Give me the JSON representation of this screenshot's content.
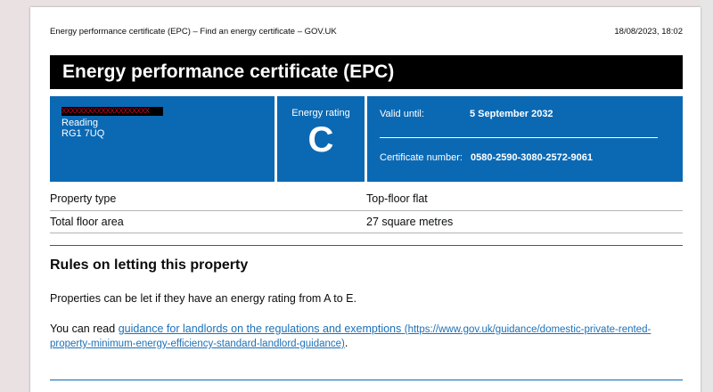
{
  "print_header": {
    "page_title": "Energy performance certificate (EPC) – Find an energy certificate – GOV.UK",
    "timestamp": "18/08/2023, 18:02"
  },
  "certificate": {
    "heading": "Energy performance certificate (EPC)",
    "address": {
      "line1_redacted": "XXXXXXXXXXXXXXXXXXXX",
      "town": "Reading",
      "postcode": "RG1 7UQ"
    },
    "rating_label": "Energy rating",
    "rating": "C",
    "valid_until_label": "Valid until:",
    "valid_until": "5 September 2032",
    "cert_number_label": "Certificate number:",
    "cert_number": "0580-2590-3080-2572-9061"
  },
  "summary": [
    {
      "label": "Property type",
      "value": "Top-floor flat"
    },
    {
      "label": "Total floor area",
      "value": "27 square metres"
    }
  ],
  "letting": {
    "heading": "Rules on letting this property",
    "intro": "Properties can be let if they have an energy rating from A to E.",
    "read_prefix": "You can read ",
    "link_text": "guidance for landlords on the regulations and exemptions",
    "link_url": "(https://www.gov.uk/guidance/domestic-private-rented-property-minimum-energy-efficiency-standard-landlord-guidance)",
    "read_suffix": "."
  },
  "colors": {
    "gov_blue": "#0b69b4",
    "title_black": "#000000",
    "link_blue": "#1d70b8"
  }
}
